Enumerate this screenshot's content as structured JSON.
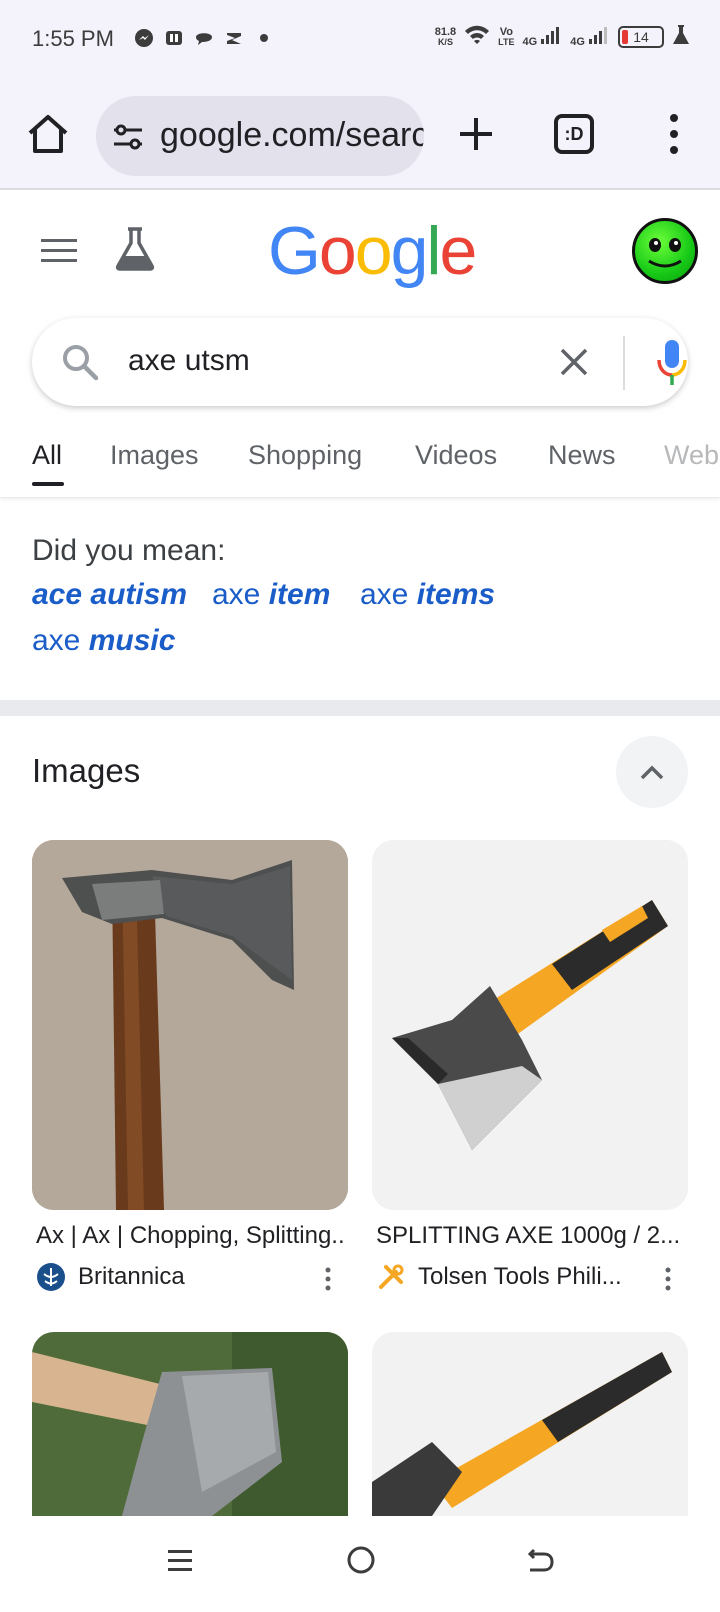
{
  "status_bar": {
    "time": "1:55 PM",
    "net_speed_value": "81.8",
    "net_speed_unit": "K/S",
    "volte_top": "Vo",
    "volte_bottom": "LTE",
    "signal1_label": "4G",
    "signal2_label": "4G",
    "battery_level": "14"
  },
  "browser": {
    "url": "google.com/search",
    "tabs_label": ":D"
  },
  "google": {
    "logo_letters": [
      "G",
      "o",
      "o",
      "g",
      "l",
      "e"
    ],
    "logo_colors": [
      "#4285F4",
      "#EA4335",
      "#FBBC05",
      "#4285F4",
      "#34A853",
      "#EA4335"
    ]
  },
  "search": {
    "query": "axe utsm"
  },
  "tabs": [
    "All",
    "Images",
    "Shopping",
    "Videos",
    "News",
    "Web"
  ],
  "did_you_mean": {
    "label": "Did you mean:",
    "suggestions": [
      {
        "plain": "",
        "bold": "ace autism"
      },
      {
        "plain": "axe ",
        "bold": "item"
      },
      {
        "plain": "axe ",
        "bold": "items"
      },
      {
        "plain": "axe ",
        "bold": "music"
      }
    ]
  },
  "images_section": {
    "title": "Images",
    "results": [
      {
        "title": "Ax | Ax | Chopping, Splitting...",
        "source": "Britannica"
      },
      {
        "title": "SPLITTING AXE 1000g / 2...",
        "source": "Tolsen Tools Phili..."
      }
    ]
  },
  "colors": {
    "link": "#1a5dc8",
    "accent_orange": "#f5a623"
  }
}
